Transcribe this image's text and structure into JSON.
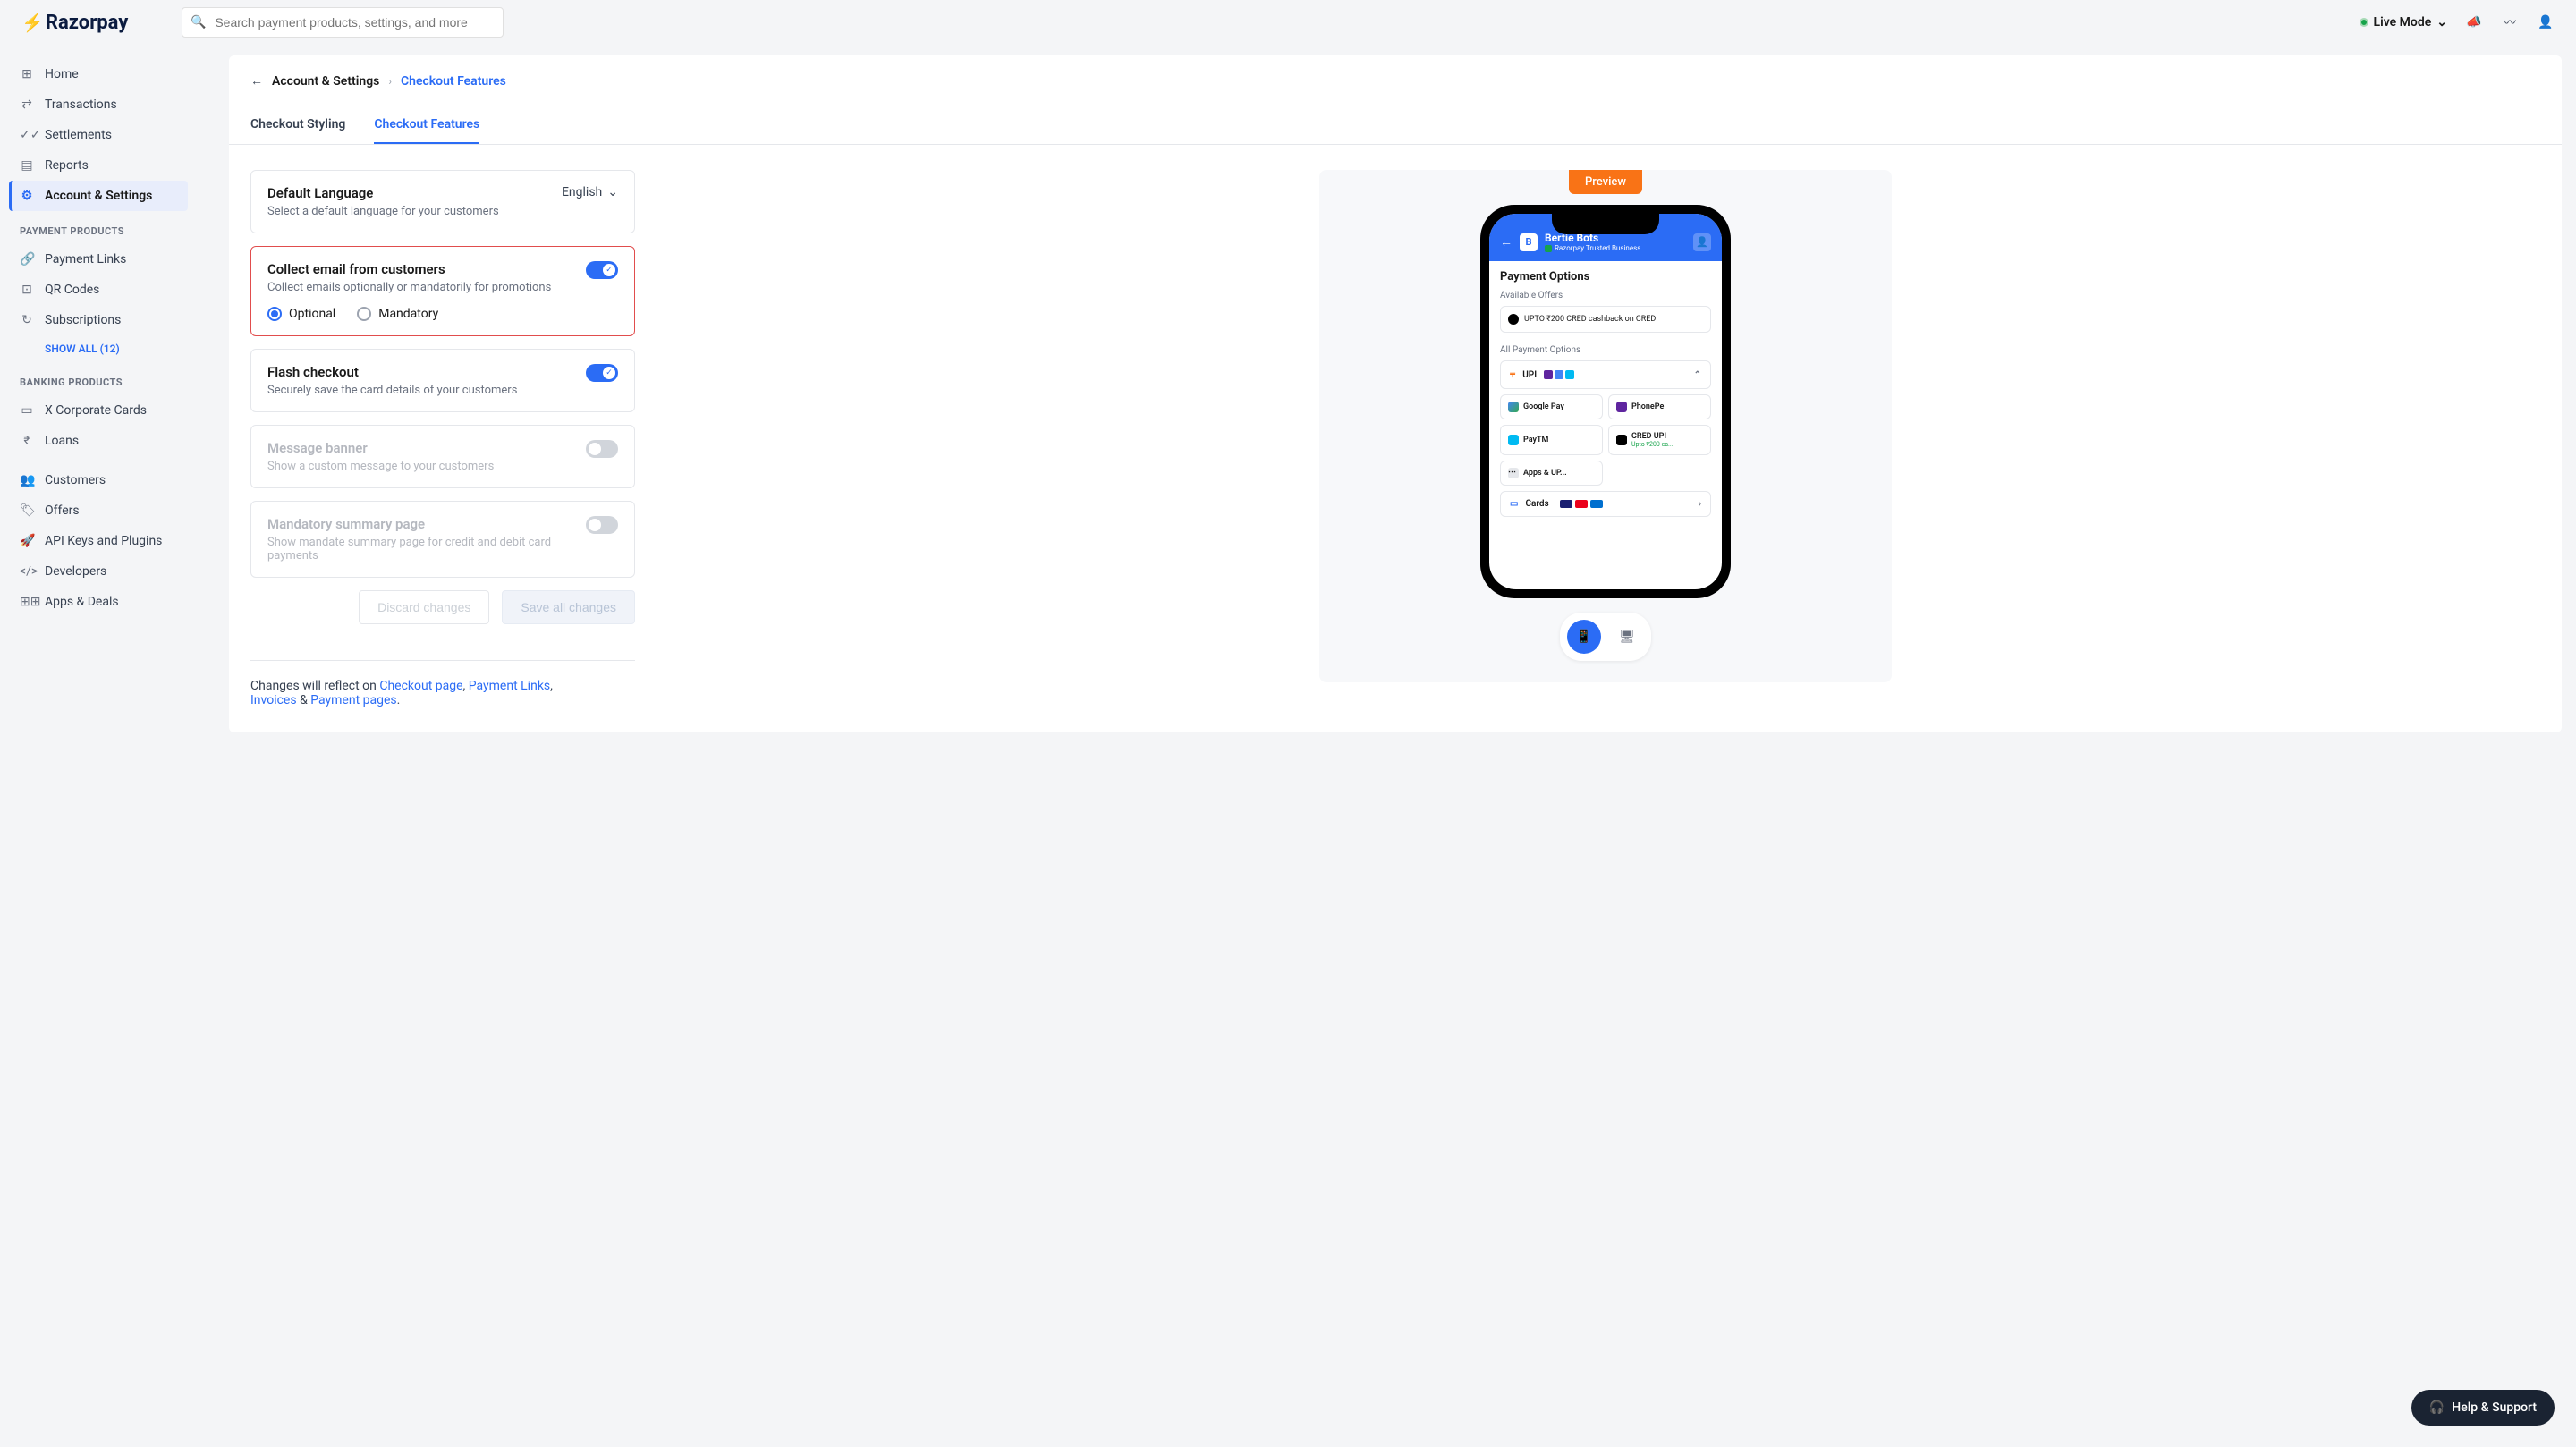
{
  "header": {
    "logo_text": "Razorpay",
    "search_placeholder": "Search payment products, settings, and more",
    "mode_label": "Live Mode"
  },
  "sidebar": {
    "main_items": [
      {
        "icon": "⊞",
        "label": "Home"
      },
      {
        "icon": "⇄",
        "label": "Transactions"
      },
      {
        "icon": "✓✓",
        "label": "Settlements"
      },
      {
        "icon": "▤",
        "label": "Reports"
      },
      {
        "icon": "⚙",
        "label": "Account & Settings",
        "active": true
      }
    ],
    "payment_section_title": "PAYMENT PRODUCTS",
    "payment_items": [
      {
        "icon": "🔗",
        "label": "Payment Links"
      },
      {
        "icon": "⊡",
        "label": "QR Codes"
      },
      {
        "icon": "↻",
        "label": "Subscriptions"
      }
    ],
    "show_all_label": "SHOW ALL (12)",
    "banking_section_title": "BANKING PRODUCTS",
    "banking_items": [
      {
        "icon": "▭",
        "label": "X Corporate Cards"
      },
      {
        "icon": "₹",
        "label": "Loans"
      }
    ],
    "other_items": [
      {
        "icon": "👥",
        "label": "Customers"
      },
      {
        "icon": "🏷",
        "label": "Offers"
      },
      {
        "icon": "🚀",
        "label": "API Keys and Plugins"
      },
      {
        "icon": "</>",
        "label": "Developers"
      },
      {
        "icon": "⊞⊞",
        "label": "Apps & Deals"
      }
    ]
  },
  "breadcrumb": {
    "item1": "Account & Settings",
    "item2": "Checkout Features"
  },
  "tabs": {
    "styling": "Checkout Styling",
    "features": "Checkout Features"
  },
  "settings": {
    "lang": {
      "title": "Default Language",
      "sub": "Select a default language for your customers",
      "value": "English"
    },
    "email": {
      "title": "Collect email from customers",
      "sub": "Collect emails optionally or mandatorily for promotions",
      "opt1": "Optional",
      "opt2": "Mandatory"
    },
    "flash": {
      "title": "Flash checkout",
      "sub": "Securely save the card details of your customers"
    },
    "banner": {
      "title": "Message banner",
      "sub": "Show a custom message to your customers"
    },
    "summary": {
      "title": "Mandatory summary page",
      "sub": "Show mandate summary page for credit and debit card payments"
    }
  },
  "actions": {
    "discard": "Discard changes",
    "save": "Save all changes"
  },
  "note": {
    "prefix": "Changes will reflect on ",
    "link1": "Checkout page",
    "link2": "Payment Links",
    "link3": "Invoices",
    "amp": " & ",
    "link4": "Payment pages"
  },
  "preview": {
    "badge": "Preview",
    "biz_initial": "B",
    "biz_name": "Bertie Bots",
    "biz_tag": "Razorpay Trusted Business",
    "options_title": "Payment Options",
    "offers_label": "Available Offers",
    "offer_text": "UPTO ₹200 CRED cashback on CRED",
    "all_options": "All Payment Options",
    "upi": "UPI",
    "gpay": "Google Pay",
    "phonepe": "PhonePe",
    "paytm": "PayTM",
    "cred": "CRED UPI",
    "cred_sub": "Upto ₹200 ca...",
    "more": "Apps & UP...",
    "cards": "Cards"
  },
  "help_label": "Help & Support"
}
